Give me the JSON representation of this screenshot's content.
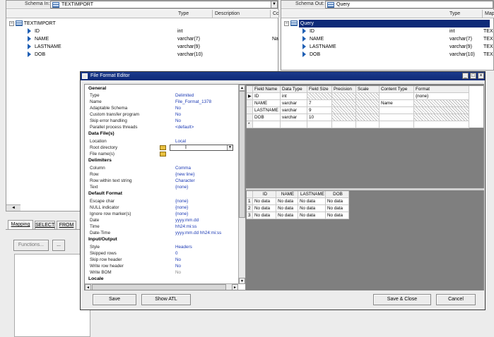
{
  "left_pane": {
    "schema_label": "Schema In:",
    "schema_value": "TEXTIMPORT",
    "columns": [
      "Type",
      "Description",
      "Co"
    ],
    "root": "TEXTIMPORT",
    "fields": [
      {
        "name": "ID",
        "type": "int",
        "extra": ""
      },
      {
        "name": "NAME",
        "type": "varchar(7)",
        "extra": "Na"
      },
      {
        "name": "LASTNAME",
        "type": "varchar(9)",
        "extra": ""
      },
      {
        "name": "DOB",
        "type": "varchar(10)",
        "extra": ""
      }
    ]
  },
  "right_pane": {
    "schema_label": "Schema Out:",
    "schema_value": "Query",
    "columns": [
      "Type",
      "Mapp"
    ],
    "root": "Query",
    "fields": [
      {
        "name": "ID",
        "type": "int",
        "extra": "TEX"
      },
      {
        "name": "NAME",
        "type": "varchar(7)",
        "extra": "TEX"
      },
      {
        "name": "LASTNAME",
        "type": "varchar(9)",
        "extra": "TEX"
      },
      {
        "name": "DOB",
        "type": "varchar(10)",
        "extra": "TEX"
      }
    ]
  },
  "bottom_tabs": [
    "Mapping",
    "SELECT",
    "FROM"
  ],
  "bottom_buttons": [
    "Functions...",
    "..."
  ],
  "dialog": {
    "title": "File Format Editor",
    "properties": {
      "general": {
        "header": "General",
        "rows": [
          {
            "label": "Type",
            "value": "Delimited"
          },
          {
            "label": "Name",
            "value": "File_Format_1378"
          },
          {
            "label": "Adaptable Schema",
            "value": "No"
          },
          {
            "label": "Custom transfer program",
            "value": "No"
          },
          {
            "label": "Skip error handling",
            "value": "No"
          },
          {
            "label": "Parallel process threads",
            "value": "<default>"
          }
        ]
      },
      "data_files": {
        "header": "Data File(s)",
        "rows": [
          {
            "label": "Location",
            "value": "Local"
          },
          {
            "label": "Root directory",
            "value": ""
          },
          {
            "label": "File name(s)",
            "value": ""
          }
        ]
      },
      "delimiters": {
        "header": "Delimiters",
        "rows": [
          {
            "label": "Column",
            "value": "Comma"
          },
          {
            "label": "Row",
            "value": "{new line}"
          },
          {
            "label": "Row within text string",
            "value": "Character"
          },
          {
            "label": "Text",
            "value": "{none}"
          }
        ]
      },
      "default_format": {
        "header": "Default Format",
        "rows": [
          {
            "label": "Escape char",
            "value": "{none}"
          },
          {
            "label": "NULL indicator",
            "value": "{none}"
          },
          {
            "label": "Ignore row marker(s)",
            "value": "{none}"
          },
          {
            "label": "Date",
            "value": "yyyy.mm.dd"
          },
          {
            "label": "Time",
            "value": "hh24:mi:ss"
          },
          {
            "label": "Date-Time",
            "value": "yyyy.mm.dd hh24:mi:ss"
          }
        ]
      },
      "input_output": {
        "header": "Input/Output",
        "rows": [
          {
            "label": "Style",
            "value": "Headers"
          },
          {
            "label": "Skipped rows",
            "value": "0"
          },
          {
            "label": "Skip row header",
            "value": "No"
          },
          {
            "label": "Write row header",
            "value": "No"
          },
          {
            "label": "Write BOM",
            "value": "No"
          }
        ]
      },
      "locale": {
        "header": "Locale"
      }
    },
    "schema_grid": {
      "columns": [
        "Field Name",
        "Data Type",
        "Field Size",
        "Precision",
        "Scale",
        "Content Type",
        "Format"
      ],
      "rows": [
        {
          "field": "ID",
          "dtype": "int",
          "size": "",
          "content": "",
          "format": "{none}"
        },
        {
          "field": "NAME",
          "dtype": "varchar",
          "size": "7",
          "content": "Name",
          "format": ""
        },
        {
          "field": "LASTNAME",
          "dtype": "varchar",
          "size": "9",
          "content": "",
          "format": ""
        },
        {
          "field": "DOB",
          "dtype": "varchar",
          "size": "10",
          "content": "",
          "format": ""
        }
      ],
      "new_row_marker": "*"
    },
    "data_grid": {
      "columns": [
        "ID",
        "NAME",
        "LASTNAME",
        "DOB"
      ],
      "rows": [
        {
          "num": "1",
          "cells": [
            "No data",
            "No data",
            "No data",
            "No data"
          ]
        },
        {
          "num": "2",
          "cells": [
            "No data",
            "No data",
            "No data",
            "No data"
          ]
        },
        {
          "num": "3",
          "cells": [
            "No data",
            "No data",
            "No data",
            "No data"
          ]
        }
      ]
    },
    "buttons": {
      "save": "Save",
      "show_atl": "Show ATL",
      "save_close": "Save & Close",
      "cancel": "Cancel"
    }
  }
}
